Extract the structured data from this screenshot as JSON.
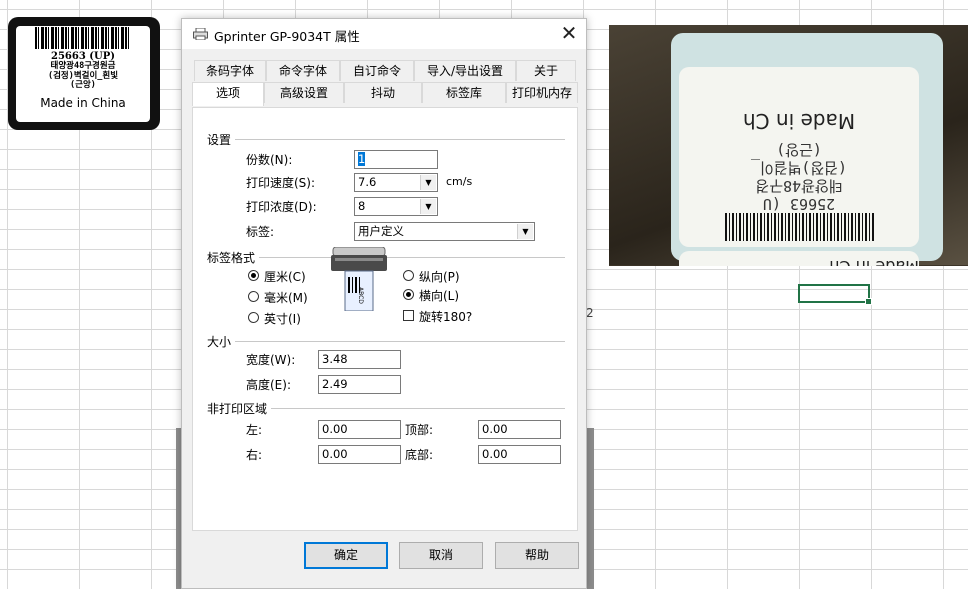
{
  "dialog": {
    "title": "Gprinter  GP-9034T 属性",
    "close_glyph": "✕",
    "tabs_row1": [
      "条码字体",
      "命令字体",
      "自订命令",
      "导入/导出设置",
      "关于"
    ],
    "tabs_row2": [
      "选项",
      "高级设置",
      "抖动",
      "标签库",
      "打印机内存"
    ],
    "active_tab": "选项",
    "settings": {
      "group_label": "设置",
      "copies_label": "份数(N):",
      "copies_value": "1",
      "speed_label": "打印速度(S):",
      "speed_value": "7.6",
      "speed_unit": "cm/s",
      "density_label": "打印浓度(D):",
      "density_value": "8",
      "stock_label": "标签:",
      "stock_value": "用户定义"
    },
    "format": {
      "group_label": "标签格式",
      "units": [
        {
          "label": "厘米(C)",
          "selected": true
        },
        {
          "label": "毫米(M)",
          "selected": false
        },
        {
          "label": "英寸(I)",
          "selected": false
        }
      ],
      "orientation": [
        {
          "label": "纵向(P)",
          "selected": false
        },
        {
          "label": "横向(L)",
          "selected": true
        }
      ],
      "rotate_label": "旋转180?",
      "rotate_checked": false,
      "preview_text": "ABCD"
    },
    "size": {
      "group_label": "大小",
      "width_label": "宽度(W):",
      "width_value": "3.48",
      "height_label": "高度(E):",
      "height_value": "2.49"
    },
    "margins": {
      "group_label": "非打印区域",
      "left_label": "左:",
      "left_value": "0.00",
      "top_label": "顶部:",
      "top_value": "0.00",
      "right_label": "右:",
      "right_value": "0.00",
      "bottom_label": "底部:",
      "bottom_value": "0.00"
    },
    "buttons": {
      "ok": "确定",
      "cancel": "取消",
      "help": "帮助"
    }
  },
  "label_preview": {
    "code": "25663 (UP)",
    "line1": "태양광48구경원금",
    "line2": "(검정)벽걸이_흰빛",
    "line3": "(근앙)",
    "made": "Made in China"
  },
  "photo": {
    "made": "Made in Ch",
    "code": "25663 (U",
    "line1": "태양광48구경",
    "line2": "(검정)벽걸이_",
    "line3": "(근앙)",
    "bottom_text": "Made in Ch"
  },
  "sheet": {
    "stray_text": "2"
  },
  "colors": {
    "selection": "#217346",
    "default_button_border": "#0078d7"
  }
}
